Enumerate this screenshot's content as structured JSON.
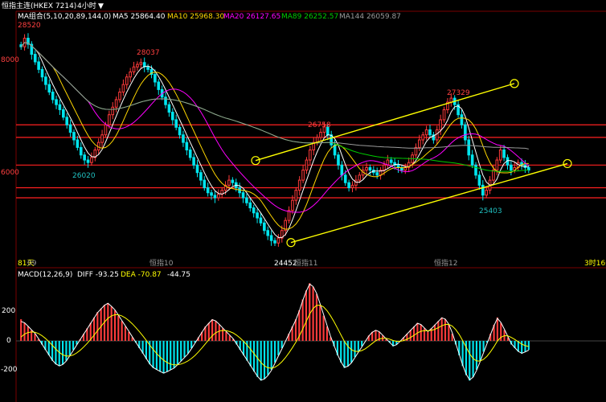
{
  "header": {
    "title": "恒指主连(HKEX 7214)",
    "period": "4小时",
    "ma_group": "MA组合(5,10,20,89,144,0)",
    "ma": [
      {
        "label": "MA5 25864.40",
        "color": "#ffffff"
      },
      {
        "label": "MA10 25968.30",
        "color": "#ffd700"
      },
      {
        "label": "MA20 26127.65",
        "color": "#ff00ff"
      },
      {
        "label": "MA89 26252.57",
        "color": "#00cc00"
      },
      {
        "label": "MA144 26059.87",
        "color": "#9a9a9a"
      }
    ]
  },
  "price_axis": {
    "labels": [
      "8000",
      "6000"
    ]
  },
  "bottom_axis": {
    "left_tag": "81天",
    "left_month": "09",
    "months": [
      "恒指10",
      "恒指11",
      "恒指12"
    ],
    "right_tag": "3时16分"
  },
  "peak_labels": [
    {
      "text": "28520",
      "color": "#ff4040"
    },
    {
      "text": "28037",
      "color": "#ff4040"
    },
    {
      "text": "26758",
      "color": "#ff4040"
    },
    {
      "text": "27329",
      "color": "#ff4040"
    },
    {
      "text": "26020",
      "color": "#20c0c0"
    },
    {
      "text": "24452",
      "color": "#ffffff"
    },
    {
      "text": "25403",
      "color": "#20c0c0"
    }
  ],
  "macd_header": {
    "name": "MACD(12,26,9)",
    "diff": "DIFF -93.25",
    "dea": "DEA -70.87",
    "macd": "-44.75"
  },
  "macd_axis": {
    "labels": [
      "200",
      "0",
      "-200"
    ]
  },
  "colors": {
    "up": "#ff3b3b",
    "down": "#00e5ee",
    "hline": "#ff2020",
    "channel": "#ffff00",
    "diff": "#ffffff",
    "dea": "#ffff00"
  },
  "chart_data": {
    "type": "candlestick",
    "price_ylim": [
      24200,
      28800
    ],
    "horizontal_levels": [
      26800,
      26550,
      26000,
      25550,
      25350
    ],
    "candles_close": [
      28350,
      28520,
      28400,
      28200,
      28050,
      27900,
      27750,
      27600,
      27450,
      27300,
      27200,
      27100,
      26950,
      26800,
      26650,
      26500,
      26350,
      26200,
      26100,
      26050,
      26150,
      26300,
      26450,
      26600,
      26800,
      27000,
      27150,
      27300,
      27450,
      27600,
      27750,
      27850,
      27950,
      28000,
      28037,
      27950,
      27900,
      27800,
      27650,
      27500,
      27350,
      27200,
      27050,
      26900,
      26750,
      26600,
      26450,
      26300,
      26150,
      26000,
      25850,
      25700,
      25550,
      25450,
      25400,
      25350,
      25420,
      25500,
      25600,
      25700,
      25650,
      25550,
      25450,
      25350,
      25250,
      25150,
      25050,
      24950,
      24850,
      24700,
      24600,
      24500,
      24452,
      24550,
      24700,
      24900,
      25100,
      25300,
      25500,
      25700,
      25900,
      26100,
      26300,
      26450,
      26550,
      26650,
      26758,
      26600,
      26400,
      26200,
      26000,
      25800,
      25650,
      25550,
      25600,
      25700,
      25800,
      25900,
      25950,
      25900,
      25850,
      25800,
      25900,
      26000,
      26100,
      26050,
      26000,
      25950,
      25900,
      25950,
      26050,
      26200,
      26350,
      26500,
      26600,
      26700,
      26600,
      26500,
      26700,
      26900,
      27100,
      27250,
      27329,
      27200,
      27000,
      26800,
      26500,
      26200,
      26000,
      25800,
      25600,
      25403,
      25500,
      25700,
      25900,
      26100,
      26300,
      26150,
      26000,
      25900,
      25950,
      26050,
      26000,
      25950,
      25900
    ],
    "channel_upper": [
      [
        26090,
        311
      ],
      [
        27620,
        129
      ]
    ],
    "channel_lower": [
      [
        24460,
        360
      ],
      [
        26030,
        180
      ]
    ],
    "macd_ylim": [
      -330,
      330
    ],
    "macd_hist": [
      120,
      100,
      80,
      60,
      40,
      10,
      -20,
      -50,
      -80,
      -110,
      -130,
      -140,
      -130,
      -110,
      -80,
      -50,
      -20,
      10,
      40,
      70,
      100,
      130,
      160,
      180,
      200,
      210,
      190,
      170,
      140,
      110,
      80,
      50,
      20,
      -10,
      -40,
      -70,
      -100,
      -130,
      -150,
      -160,
      -170,
      -180,
      -170,
      -160,
      -150,
      -130,
      -110,
      -90,
      -70,
      -40,
      -10,
      20,
      50,
      80,
      100,
      120,
      110,
      90,
      70,
      50,
      30,
      10,
      -20,
      -50,
      -80,
      -110,
      -140,
      -170,
      -200,
      -220,
      -210,
      -190,
      -160,
      -120,
      -80,
      -40,
      0,
      40,
      80,
      120,
      170,
      230,
      280,
      320,
      300,
      260,
      200,
      140,
      80,
      20,
      -30,
      -80,
      -120,
      -150,
      -140,
      -120,
      -90,
      -60,
      -30,
      0,
      30,
      50,
      60,
      50,
      30,
      10,
      -10,
      -30,
      -20,
      0,
      20,
      40,
      60,
      80,
      100,
      90,
      70,
      50,
      70,
      90,
      110,
      130,
      120,
      90,
      40,
      -20,
      -80,
      -140,
      -190,
      -220,
      -200,
      -160,
      -110,
      -60,
      -10,
      40,
      90,
      130,
      100,
      60,
      20,
      -20,
      -40,
      -60,
      -70,
      -60,
      -50
    ]
  }
}
